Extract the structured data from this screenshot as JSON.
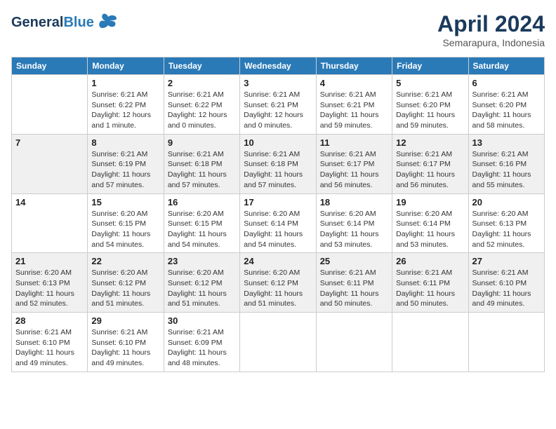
{
  "header": {
    "logo_line1": "General",
    "logo_line2": "Blue",
    "month": "April 2024",
    "location": "Semarapura, Indonesia"
  },
  "days_of_week": [
    "Sunday",
    "Monday",
    "Tuesday",
    "Wednesday",
    "Thursday",
    "Friday",
    "Saturday"
  ],
  "weeks": [
    [
      {
        "day": "",
        "info": ""
      },
      {
        "day": "1",
        "info": "Sunrise: 6:21 AM\nSunset: 6:22 PM\nDaylight: 12 hours\nand 1 minute."
      },
      {
        "day": "2",
        "info": "Sunrise: 6:21 AM\nSunset: 6:22 PM\nDaylight: 12 hours\nand 0 minutes."
      },
      {
        "day": "3",
        "info": "Sunrise: 6:21 AM\nSunset: 6:21 PM\nDaylight: 12 hours\nand 0 minutes."
      },
      {
        "day": "4",
        "info": "Sunrise: 6:21 AM\nSunset: 6:21 PM\nDaylight: 11 hours\nand 59 minutes."
      },
      {
        "day": "5",
        "info": "Sunrise: 6:21 AM\nSunset: 6:20 PM\nDaylight: 11 hours\nand 59 minutes."
      },
      {
        "day": "6",
        "info": "Sunrise: 6:21 AM\nSunset: 6:20 PM\nDaylight: 11 hours\nand 58 minutes."
      }
    ],
    [
      {
        "day": "7",
        "info": ""
      },
      {
        "day": "8",
        "info": "Sunrise: 6:21 AM\nSunset: 6:19 PM\nDaylight: 11 hours\nand 57 minutes."
      },
      {
        "day": "9",
        "info": "Sunrise: 6:21 AM\nSunset: 6:18 PM\nDaylight: 11 hours\nand 57 minutes."
      },
      {
        "day": "10",
        "info": "Sunrise: 6:21 AM\nSunset: 6:18 PM\nDaylight: 11 hours\nand 57 minutes."
      },
      {
        "day": "11",
        "info": "Sunrise: 6:21 AM\nSunset: 6:17 PM\nDaylight: 11 hours\nand 56 minutes."
      },
      {
        "day": "12",
        "info": "Sunrise: 6:21 AM\nSunset: 6:17 PM\nDaylight: 11 hours\nand 56 minutes."
      },
      {
        "day": "13",
        "info": "Sunrise: 6:21 AM\nSunset: 6:16 PM\nDaylight: 11 hours\nand 55 minutes."
      }
    ],
    [
      {
        "day": "14",
        "info": ""
      },
      {
        "day": "15",
        "info": "Sunrise: 6:20 AM\nSunset: 6:15 PM\nDaylight: 11 hours\nand 54 minutes."
      },
      {
        "day": "16",
        "info": "Sunrise: 6:20 AM\nSunset: 6:15 PM\nDaylight: 11 hours\nand 54 minutes."
      },
      {
        "day": "17",
        "info": "Sunrise: 6:20 AM\nSunset: 6:14 PM\nDaylight: 11 hours\nand 54 minutes."
      },
      {
        "day": "18",
        "info": "Sunrise: 6:20 AM\nSunset: 6:14 PM\nDaylight: 11 hours\nand 53 minutes."
      },
      {
        "day": "19",
        "info": "Sunrise: 6:20 AM\nSunset: 6:14 PM\nDaylight: 11 hours\nand 53 minutes."
      },
      {
        "day": "20",
        "info": "Sunrise: 6:20 AM\nSunset: 6:13 PM\nDaylight: 11 hours\nand 52 minutes."
      }
    ],
    [
      {
        "day": "21",
        "info": "Sunrise: 6:20 AM\nSunset: 6:13 PM\nDaylight: 11 hours\nand 52 minutes."
      },
      {
        "day": "22",
        "info": "Sunrise: 6:20 AM\nSunset: 6:12 PM\nDaylight: 11 hours\nand 51 minutes."
      },
      {
        "day": "23",
        "info": "Sunrise: 6:20 AM\nSunset: 6:12 PM\nDaylight: 11 hours\nand 51 minutes."
      },
      {
        "day": "24",
        "info": "Sunrise: 6:20 AM\nSunset: 6:12 PM\nDaylight: 11 hours\nand 51 minutes."
      },
      {
        "day": "25",
        "info": "Sunrise: 6:21 AM\nSunset: 6:11 PM\nDaylight: 11 hours\nand 50 minutes."
      },
      {
        "day": "26",
        "info": "Sunrise: 6:21 AM\nSunset: 6:11 PM\nDaylight: 11 hours\nand 50 minutes."
      },
      {
        "day": "27",
        "info": "Sunrise: 6:21 AM\nSunset: 6:10 PM\nDaylight: 11 hours\nand 49 minutes."
      }
    ],
    [
      {
        "day": "28",
        "info": "Sunrise: 6:21 AM\nSunset: 6:10 PM\nDaylight: 11 hours\nand 49 minutes."
      },
      {
        "day": "29",
        "info": "Sunrise: 6:21 AM\nSunset: 6:10 PM\nDaylight: 11 hours\nand 49 minutes."
      },
      {
        "day": "30",
        "info": "Sunrise: 6:21 AM\nSunset: 6:09 PM\nDaylight: 11 hours\nand 48 minutes."
      },
      {
        "day": "",
        "info": ""
      },
      {
        "day": "",
        "info": ""
      },
      {
        "day": "",
        "info": ""
      },
      {
        "day": "",
        "info": ""
      }
    ]
  ]
}
